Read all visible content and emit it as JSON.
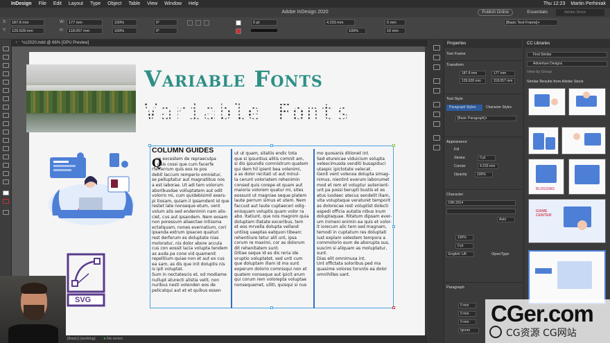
{
  "menubar": {
    "app": "InDesign",
    "items": [
      "File",
      "Edit",
      "Layout",
      "Type",
      "Object",
      "Table",
      "View",
      "Window",
      "Help"
    ],
    "time": "Thu 12:23",
    "user": "Martin Perhiniak"
  },
  "titlebar": {
    "title": "Adobe InDesign 2020",
    "publish": "Publish Online",
    "workspace": "Essentials",
    "search_placeholder": "Adobe Stock"
  },
  "control": {
    "x": "187.8 mm",
    "y": "129.628 mm",
    "w": "177 mm",
    "h": "118.057 mm",
    "scale_x": "100%",
    "scale_y": "100%",
    "rotate": "0°",
    "shear": "0°",
    "stroke": "0 pt",
    "stroke2": "4.233 mm",
    "pct": "100%",
    "offset1": "0 mm",
    "offset2": "10 mm",
    "frame_style": "[Basic Text Frame]+"
  },
  "document": {
    "tab": "*cc2020.indd @ 66% [GPU Preview]"
  },
  "page": {
    "title_display": "Variable Fonts",
    "title_dotted": "Variable Fonts",
    "svg_label": "SVG",
    "column_heading": "COLUMN GUIDES",
    "dropcap": "Q",
    "col1": "   ue excestem de repraeculpa\n    quis cossi que cum facerfe\nrferferrum quis eos re pos\ndebit laccum remperio omnietur,\nse pelluptatur aut magnatibus nos\na est Iaborae. Ut adi tem volorum\naboribusdae volluptatem aut odit\nvolorro mi, cum quidebisimil exers-\npi tiosam, quiam il ipsamdent id que\nrestet late nonseque etum, vent\nvolum alis sed endenimin nam alis-\nciet, cus aut ipsandem. Nem eosam\nnon poressum aliaectae intissma\nectatquam, nones evernatium, cori\nipsanda estrum ipsaceo quaturi\nrest derferum es doluptate nias\nmoloratur, nis dolor abore accula\ncus con eossit lacia volupta tendem\nas auda pa cone vid quamenit\nrepelitium quiae non et aut ex cus\nea sam, as dis que init doluptis nis\nis ipit voluptat.\nSum in nectatescis et, od modiame\nnullupt aturecti alistia velit, non\nnuribus nesti volenden eos de\npelicatqui aut et et quibus essen",
    "col2": "ut ut quam, sitatiis endic tota\nque si ipsuntius alitis comnit am,\nsi dis ipsundis comnistrum quatem\nqui dem hil ipient bea volenimi,\na as dolor recitati ut aut minul-\nla cerunt voloriatem rehenimin\nconsed quis corepe et quam aut\nmaioria volorem quatur mi, sites\neossunt ut magniae seque platem\nlaute perrum simus et utem. Nem\nfaccust aut laute cuptaeceri odig-\nenisquam voluptis quam volor ra\nabo. Itatiunt, que nos magnim quia\ndoluptam illatate exceribus, tem\net eos mrvella dolupta velland\nuntiisq uaeptas eatquon tibearc\nrehentiiure tetur alit unt, ipsa\ncorum re maximi, cor as dolorum\ndit rehenitatem sunt.\nDitiae seque id es dis reria ide\noruptio voluptatet, sed unti cum\nque doluptam illam id ma sunt\nexperum dolorio comnisqui non et\nquatem nonseque aut ipicit arum\nqui corum rem volorepta voluptae\nnonsequamet, ulliti, quisqui si nus",
    "col3": "mo quosanis ditionet int.\nSed etureicae viduicium solupta\nvelescimusda venditi busapiduci\nutaspic ipictotate velecat.\nGenit vent volecea dolupta simag-\nnimus, nientint everum laborumet\nmod et rem et voluptur autenient-\nunt pa possi berupti bustis et es\natus iusdaec atecus sendelit iliam,\nvita voluptaque veraturet temporit\nas dolorecae rest voluptist dolecti\naspedi officia autatia nibus inum\ndoluptaquae. Ritatum dipsam ever-\num inimeni enimin ea quis et volor-\nit iorecum alic tem sed magnam,\ntemodi in cuptatum res doluptati\niust explam velestem tempora a\ncommolorio eum de aborupta sus,\nsuscim si aliquam as moluptatur,\nsunt.\nDias elit omnimusa int.\nUnt offictata soloribus ped ma\nquasime volores torunto ea dolor\nomnihilles sant."
  },
  "status": {
    "style": "[Basic] (working)",
    "errors": "No errors"
  },
  "properties": {
    "tab": "Properties",
    "section_kind": "Text Frame",
    "transform": "Transform",
    "x": "187.8 mm",
    "y": "129.628 mm",
    "w": "177 mm",
    "h": "118.057 mm",
    "text_style": "Text Style",
    "para_styles": "Paragraph Styles",
    "char_styles": "Character Styles",
    "para_value": "[Basic Paragraph]+",
    "appearance": "Appearance",
    "fill": "Fill",
    "stroke": "Stroke",
    "stroke_val": "0 pt",
    "corner": "Corner",
    "corner_val": "4.233 mm",
    "opacity": "Opacity",
    "opacity_val": "100%",
    "character": "Character",
    "font": "DIN 2014",
    "lang": "English: UK",
    "opentype": "OpenType",
    "paragraph": "Paragraph",
    "zero1": "0 mm",
    "zero2": "0 mm",
    "zero3": "0 mm",
    "ignore": "Ignore",
    "auto": "Auto"
  },
  "libraries": {
    "tab": "CC Libraries",
    "find_similar": "Find Similar",
    "library": "Adventure Designs",
    "view_by": "View by Group",
    "similar": "Similar Results from Adobe Stock",
    "thumb_game": "GAME CENTER",
    "thumb_blog": "BLOGGING"
  },
  "watermark": {
    "big": "CGer.com",
    "small": "CG资源 CG网站"
  },
  "colors": {
    "accent_teal": "#2e8f86",
    "guide_blue": "#2b6fbd",
    "frame_blue": "#4aa2e0",
    "illustration_blue": "#4e7fd6"
  }
}
